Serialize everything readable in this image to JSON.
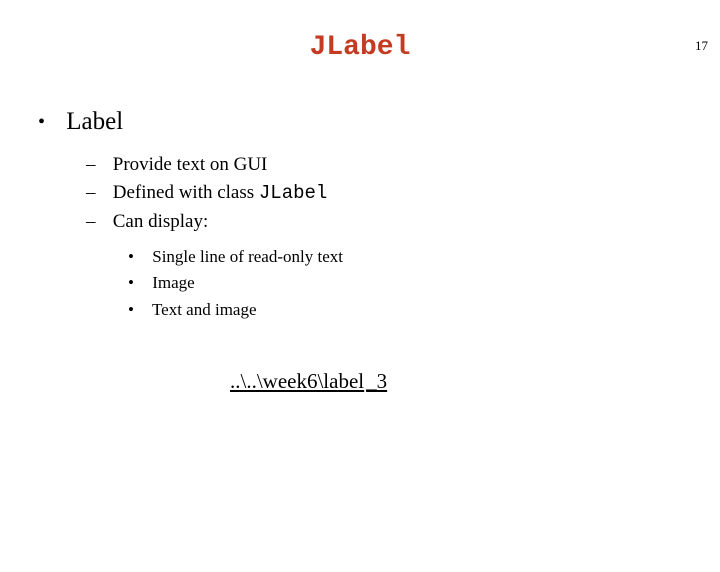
{
  "pageNumber": "17",
  "title": "JLabel",
  "level1": [
    {
      "label": "Label"
    }
  ],
  "level2": [
    {
      "text": "Provide text on GUI"
    },
    {
      "textPrefix": "Defined with class ",
      "code": "JLabel"
    },
    {
      "text": "Can display:"
    }
  ],
  "level3": [
    {
      "text": "Single line of read-only text"
    },
    {
      "text": "Image"
    },
    {
      "text": "Text and image"
    }
  ],
  "linkPath": "..\\..\\week6\\label",
  "linkTail": "_3"
}
